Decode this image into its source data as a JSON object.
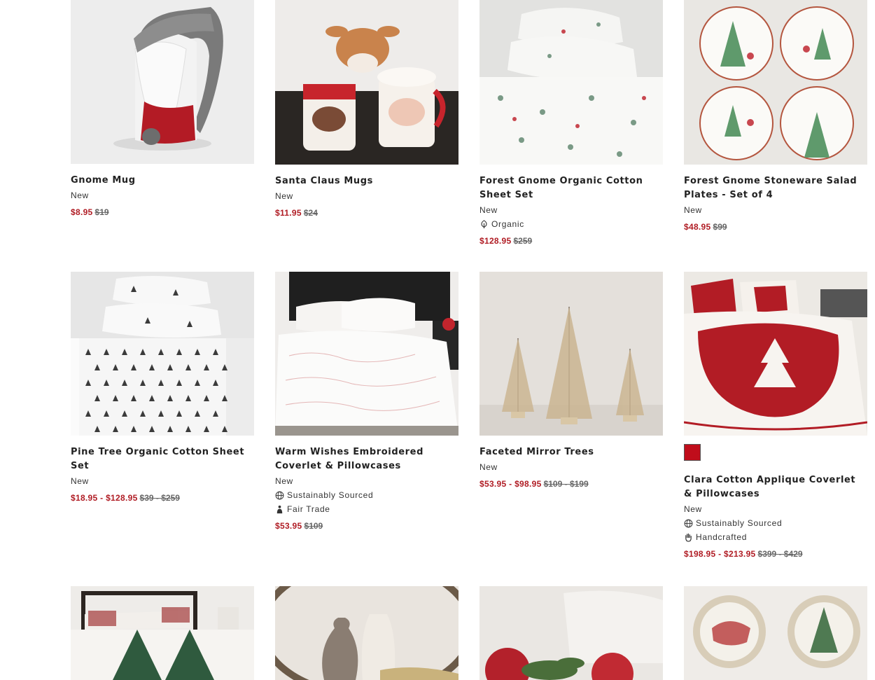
{
  "products": [
    {
      "name": "Gnome Mug",
      "flag": "New",
      "attrs": [],
      "sale": "$8.95",
      "regular": "$19"
    },
    {
      "name": "Santa Claus Mugs",
      "flag": "New",
      "attrs": [],
      "sale": "$11.95",
      "regular": "$24"
    },
    {
      "name": "Forest Gnome Organic Cotton Sheet Set",
      "flag": "New",
      "attrs": [
        {
          "icon": "leaf-icon",
          "label": "Organic"
        }
      ],
      "sale": "$128.95",
      "regular": "$259"
    },
    {
      "name": "Forest Gnome Stoneware Salad Plates - Set of 4",
      "flag": "New",
      "attrs": [],
      "sale": "$48.95",
      "regular": "$99"
    },
    {
      "name": "Pine Tree Organic Cotton Sheet Set",
      "flag": "New",
      "attrs": [],
      "sale": "$18.95 - $128.95",
      "regular": "$39 - $259"
    },
    {
      "name": "Warm Wishes Embroidered Coverlet & Pillowcases",
      "flag": "New",
      "attrs": [
        {
          "icon": "globe-icon",
          "label": "Sustainably Sourced"
        },
        {
          "icon": "fair-trade-icon",
          "label": "Fair Trade"
        }
      ],
      "sale": "$53.95",
      "regular": "$109"
    },
    {
      "name": "Faceted Mirror Trees",
      "flag": "New",
      "attrs": [],
      "sale": "$53.95 - $98.95",
      "regular": "$109 - $199"
    },
    {
      "name": "Clara Cotton Applique Coverlet & Pillowcases",
      "flag": "New",
      "swatch_color": "#c00d1b",
      "attrs": [
        {
          "icon": "globe-icon",
          "label": "Sustainably Sourced"
        },
        {
          "icon": "hand-icon",
          "label": "Handcrafted"
        }
      ],
      "sale": "$198.95 - $213.95",
      "regular": "$399 - $429"
    }
  ],
  "colors": {
    "sale_price": "#b01c24",
    "swatch_red": "#c00d1b"
  }
}
